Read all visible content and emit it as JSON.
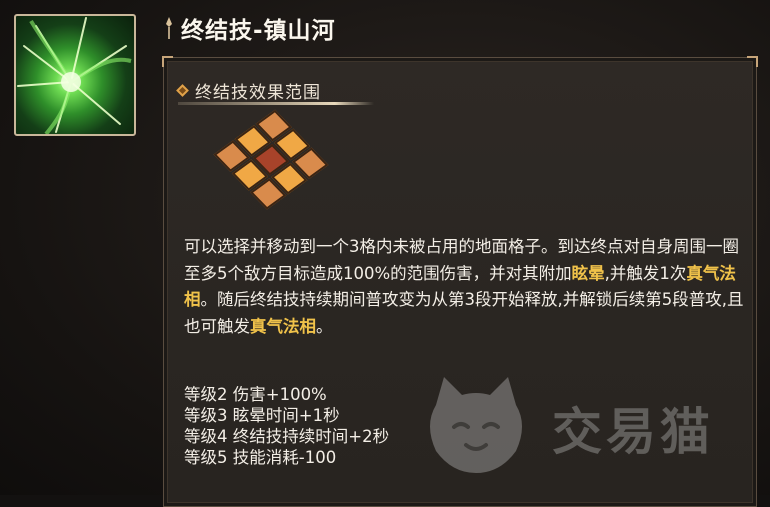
{
  "skill": {
    "title": "终结技-镇山河",
    "icon": "green-lightning-skill-icon"
  },
  "panel": {
    "section_title": "终结技效果范围",
    "description": {
      "p1": "可以选择并移动到一个3格内未被占用的地面格子。到达终点对自身周围一圈至多5个敌方目标造成100%的范围伤害，并对其附加",
      "hl1": "眩晕",
      "p2": ",并触发1次",
      "hl2": "真气法相",
      "p3": "。随后终结技持续期间普攻变为从第3段开始释放,并解锁后续第5段普攻,且也可触发",
      "hl3": "真气法相",
      "p4": "。"
    },
    "levels": [
      "等级2 伤害+100%",
      "等级3 眩晕时间+1秒",
      "等级4 终结技持续时间+2秒",
      "等级5 技能消耗-100"
    ],
    "range_grid": {
      "rows": 3,
      "cols": 3,
      "highlighted_cells": [
        [
          0,
          1
        ],
        [
          1,
          0
        ],
        [
          1,
          2
        ],
        [
          2,
          1
        ]
      ],
      "center_cell": [
        1,
        1
      ]
    }
  },
  "watermark": {
    "text": "交易猫",
    "icon": "cat-logo-icon"
  },
  "colors": {
    "highlight": "#f0c24a",
    "panel_bg": "#2b2723",
    "grid_highlight": "#f0a845",
    "grid_center": "#a8432a",
    "grid_plain": "#d98b4c"
  }
}
